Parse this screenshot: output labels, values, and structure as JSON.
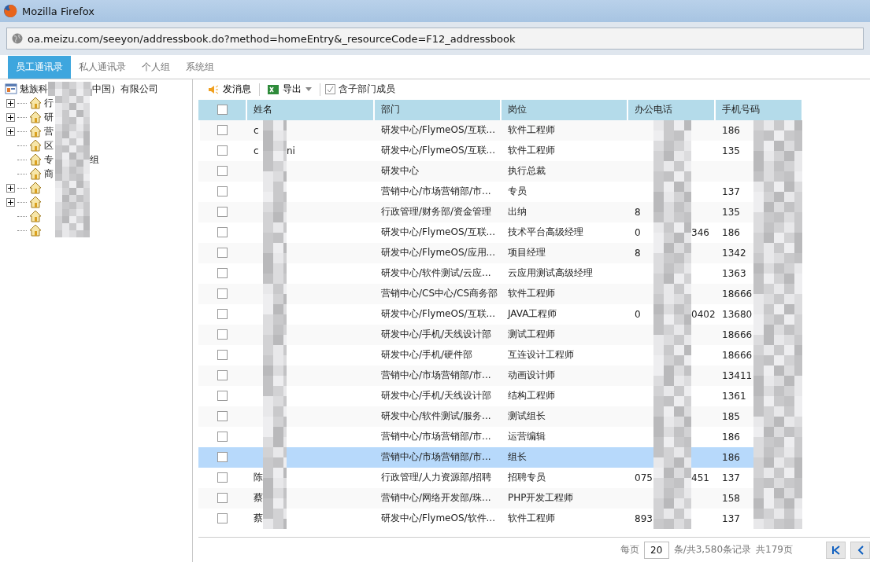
{
  "window": {
    "title": "Mozilla Firefox"
  },
  "address_bar": {
    "url": "oa.meizu.com/seeyon/addressbook.do?method=homeEntry&_resourceCode=F12_addressbook"
  },
  "tabs": [
    {
      "label": "员工通讯录",
      "selected": true
    },
    {
      "label": "私人通讯录",
      "selected": false
    },
    {
      "label": "个人组",
      "selected": false
    },
    {
      "label": "系统组",
      "selected": false
    }
  ],
  "tree": {
    "root": {
      "label": "魅族科",
      "label_tail": "中国）有限公司"
    },
    "children": [
      {
        "label": "行",
        "expandable": true
      },
      {
        "label": "研",
        "expandable": true
      },
      {
        "label": "营",
        "expandable": true
      },
      {
        "label": "区",
        "expandable": false
      },
      {
        "label": "专",
        "label_tail": "组",
        "expandable": false
      },
      {
        "label": "商",
        "expandable": false
      },
      {
        "expandable": true
      },
      {
        "expandable": true
      },
      {
        "expandable": false
      },
      {
        "expandable": false
      }
    ]
  },
  "toolbar": {
    "send_message": "发消息",
    "export": "导出",
    "include_sub": {
      "label": "含子部门成员",
      "checked": true
    }
  },
  "table": {
    "select_all_checked": false,
    "columns": [
      "姓名",
      "部门",
      "岗位",
      "办公电话",
      "手机号码"
    ],
    "rows": [
      {
        "name": "c",
        "department": "研发中心/FlymeOS/互联...",
        "position": "软件工程师",
        "mobile": "186",
        "checked": false,
        "selected": false
      },
      {
        "name": "c",
        "name_tail": "ni",
        "department": "研发中心/FlymeOS/互联...",
        "position": "软件工程师",
        "mobile": "135",
        "checked": false,
        "selected": false
      },
      {
        "department": "研发中心",
        "position": "执行总裁",
        "checked": false,
        "selected": false
      },
      {
        "department": "营销中心/市场营销部/市...",
        "position": "专员",
        "mobile": "137",
        "checked": false,
        "selected": false
      },
      {
        "department": "行政管理/财务部/资金管理",
        "position": "出纳",
        "office": "8",
        "mobile": "135",
        "checked": false,
        "selected": false
      },
      {
        "department": "研发中心/FlymeOS/互联...",
        "position": "技术平台高级经理",
        "office": "0",
        "office_tail": "346",
        "mobile": "186",
        "checked": false,
        "selected": false
      },
      {
        "department": "研发中心/FlymeOS/应用...",
        "position": "项目经理",
        "office": "8",
        "mobile": "1342",
        "checked": false,
        "selected": false
      },
      {
        "department": "研发中心/软件测试/云应...",
        "position": "云应用测试高级经理",
        "mobile": "1363",
        "checked": false,
        "selected": false
      },
      {
        "department": "营销中心/CS中心/CS商务部",
        "position": "软件工程师",
        "mobile": "18666",
        "checked": false,
        "selected": false
      },
      {
        "department": "研发中心/FlymeOS/互联...",
        "position": "JAVA工程师",
        "office": "0",
        "office_tail": "0402",
        "mobile": "13680",
        "checked": false,
        "selected": false
      },
      {
        "department": "研发中心/手机/天线设计部",
        "position": "测试工程师",
        "mobile": "18666",
        "checked": false,
        "selected": false
      },
      {
        "department": "研发中心/手机/硬件部",
        "position": "互连设计工程师",
        "mobile": "18666",
        "checked": false,
        "selected": false
      },
      {
        "department": "营销中心/市场营销部/市...",
        "position": "动画设计师",
        "mobile": "13411",
        "checked": false,
        "selected": false
      },
      {
        "department": "研发中心/手机/天线设计部",
        "position": "结构工程师",
        "mobile": "1361",
        "checked": false,
        "selected": false
      },
      {
        "department": "研发中心/软件测试/服务...",
        "position": "测试组长",
        "mobile": "185",
        "checked": false,
        "selected": false
      },
      {
        "department": "营销中心/市场营销部/市...",
        "position": "运营编辑",
        "mobile": "186",
        "checked": false,
        "selected": false
      },
      {
        "department": "营销中心/市场营销部/市...",
        "position": "组长",
        "mobile": "186",
        "checked": false,
        "selected": true
      },
      {
        "name": "陈",
        "department": "行政管理/人力资源部/招聘",
        "position": "招聘专员",
        "office": "075",
        "office_tail": "451",
        "mobile": "137",
        "checked": false,
        "selected": false
      },
      {
        "name": "蔡",
        "department": "营销中心/网络开发部/珠...",
        "position": "PHP开发工程师",
        "mobile": "158",
        "checked": false,
        "selected": false
      },
      {
        "name": "蔡",
        "department": "研发中心/FlymeOS/软件...",
        "position": "软件工程师",
        "office": "893",
        "mobile": "137",
        "checked": false,
        "selected": false
      }
    ]
  },
  "pager": {
    "per_page_label": "每页",
    "per_page": "20",
    "total_records": "条/共3,580条记录",
    "total_pages": "共179页"
  }
}
